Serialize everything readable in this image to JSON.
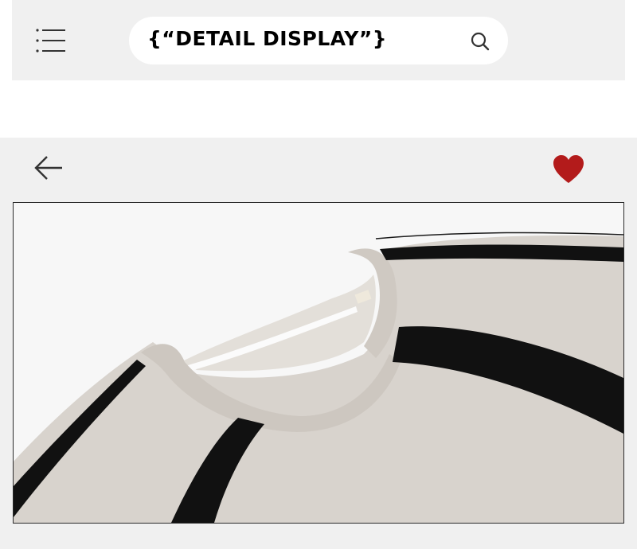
{
  "header": {
    "menu_icon": "hamburger-menu-icon",
    "search": {
      "text": "{“DETAIL DISPLAY”}",
      "icon": "search-icon"
    }
  },
  "detail": {
    "back_icon": "arrow-left-icon",
    "favorite_icon": "heart-icon",
    "favorite_color": "#b31b1b",
    "image": {
      "subject": "sweatshirt-collar-detail",
      "fabric_color": "#d9d4ce",
      "stripe_color": "#111111"
    }
  }
}
